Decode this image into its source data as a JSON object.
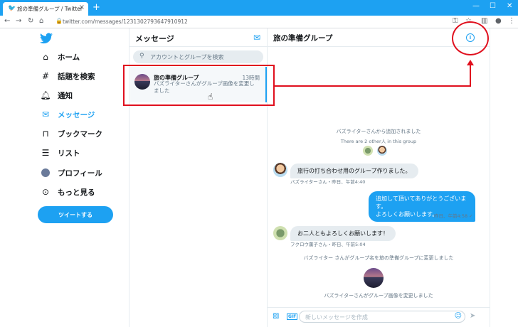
{
  "browser": {
    "tab_title": "旅の準備グループ / Twitter",
    "url": "twitter.com/messages/1231302793647910912",
    "new_tab": "+",
    "close_tab": "×"
  },
  "nav": {
    "items": [
      {
        "label": "ホーム"
      },
      {
        "label": "話題を検索"
      },
      {
        "label": "通知"
      },
      {
        "label": "メッセージ"
      },
      {
        "label": "ブックマーク"
      },
      {
        "label": "リスト"
      },
      {
        "label": "プロフィール"
      },
      {
        "label": "もっと見る"
      }
    ],
    "tweet_button": "ツイートする"
  },
  "messages": {
    "title": "メッセージ",
    "search_placeholder": "アカウントとグループを検索",
    "conversation": {
      "name": "旅の準備グループ",
      "time": "13時間",
      "snippet": "バズライターさんがグループ画像を変更しました"
    }
  },
  "chat": {
    "title": "旅の準備グループ",
    "added_notice": "バズライターさんから追加されました",
    "members_notice": "There are 2 other人 in this group",
    "msg1": {
      "text": "旅行の打ち合わせ用のグループ作りました。",
      "meta": "バズライターさん・昨日、午前4:40"
    },
    "msg2": {
      "line1": "追加して頂いてありがとうございます。",
      "line2": "よろしくお願いします。",
      "meta": "昨日、午前4:58 ✓"
    },
    "msg3": {
      "text": "お二人ともよろしくお願いします！",
      "meta": "フクロウ薫子さん・昨日、午前5:04"
    },
    "rename_notice": "バズライター さんがグループ名を旅の準備グループに変更しました",
    "image_notice": "バズライターさんがグループ画像を変更しました",
    "composer_placeholder": "新しいメッセージを作成"
  },
  "colors": {
    "accent": "#1da1f2",
    "annotation": "#e0101e"
  }
}
